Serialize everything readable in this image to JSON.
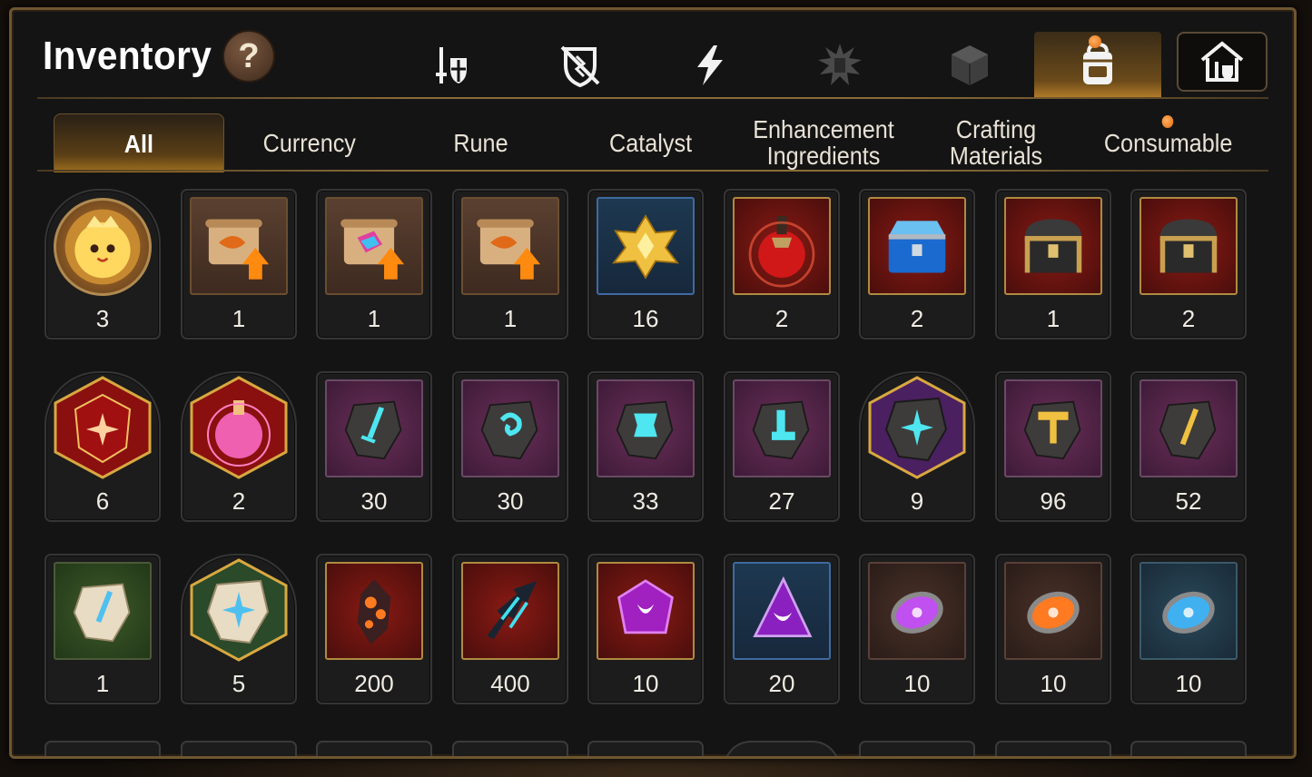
{
  "window": {
    "title": "Inventory",
    "help_label": "?"
  },
  "top_tabs": [
    {
      "icon": "sword-shield-icon",
      "active": false
    },
    {
      "icon": "broken-shield-icon",
      "active": false
    },
    {
      "icon": "lightning-icon",
      "active": false
    },
    {
      "icon": "burst-emblem-icon",
      "active": false
    },
    {
      "icon": "cube-icon",
      "active": false
    },
    {
      "icon": "backpack-icon",
      "active": true,
      "badge": true
    },
    {
      "icon": "storage-house-icon",
      "active": false
    }
  ],
  "category_tabs": [
    {
      "label": "All",
      "active": true
    },
    {
      "label": "Currency",
      "active": false
    },
    {
      "label": "Rune",
      "active": false
    },
    {
      "label": "Catalyst",
      "active": false
    },
    {
      "label": "Enhancement Ingredients",
      "active": false
    },
    {
      "label": "Crafting Materials",
      "active": false
    },
    {
      "label": "Consumable",
      "active": false,
      "badge": true
    }
  ],
  "items": [
    [
      {
        "icon": "golden-mascot-coin-icon",
        "frame": "round",
        "count": "3"
      },
      {
        "icon": "orange-scroll-upgrade-icon",
        "frame": "brown",
        "count": "1"
      },
      {
        "icon": "rainbow-scroll-upgrade-icon",
        "frame": "brown",
        "count": "1"
      },
      {
        "icon": "orange-scroll-upgrade-icon",
        "frame": "brown",
        "count": "1"
      },
      {
        "icon": "gold-crystal-cluster-icon",
        "frame": "blue",
        "count": "16"
      },
      {
        "icon": "red-potion-flask-icon",
        "frame": "red",
        "count": "2"
      },
      {
        "icon": "blue-treasure-chest-icon",
        "frame": "red",
        "count": "2"
      },
      {
        "icon": "dark-treasure-chest-icon",
        "frame": "red",
        "count": "1"
      },
      {
        "icon": "dark-treasure-chest-icon",
        "frame": "red",
        "count": "2"
      }
    ],
    [
      {
        "icon": "red-star-rune-icon",
        "frame": "hex-red",
        "count": "6"
      },
      {
        "icon": "pink-potion-rune-icon",
        "frame": "hex-red",
        "count": "2"
      },
      {
        "icon": "sword-rune-stone-icon",
        "frame": "purple",
        "count": "30"
      },
      {
        "icon": "spiral-rune-stone-icon",
        "frame": "purple",
        "count": "30"
      },
      {
        "icon": "armor-rune-stone-icon",
        "frame": "purple",
        "count": "33"
      },
      {
        "icon": "boot-rune-stone-icon",
        "frame": "purple",
        "count": "27"
      },
      {
        "icon": "star-rune-stone-icon",
        "frame": "hex-purple",
        "count": "9"
      },
      {
        "icon": "hammer-rune-stone-icon",
        "frame": "purple",
        "count": "96"
      },
      {
        "icon": "slash-rune-stone-icon",
        "frame": "purple",
        "count": "52"
      }
    ],
    [
      {
        "icon": "sword-pale-stone-icon",
        "frame": "green",
        "count": "1"
      },
      {
        "icon": "star-pale-stone-icon",
        "frame": "hex-green",
        "count": "5"
      },
      {
        "icon": "ember-crystal-icon",
        "frame": "red",
        "count": "200"
      },
      {
        "icon": "frost-claw-icon",
        "frame": "red",
        "count": "400"
      },
      {
        "icon": "violet-moon-gem-icon",
        "frame": "red",
        "count": "10"
      },
      {
        "icon": "violet-moon-shard-icon",
        "frame": "blue",
        "count": "20"
      },
      {
        "icon": "purple-moon-orb-icon",
        "frame": "dark",
        "count": "10"
      },
      {
        "icon": "orange-flame-orb-icon",
        "frame": "dark",
        "count": "10"
      },
      {
        "icon": "blue-snowflake-orb-icon",
        "frame": "teal",
        "count": "10"
      }
    ]
  ]
}
